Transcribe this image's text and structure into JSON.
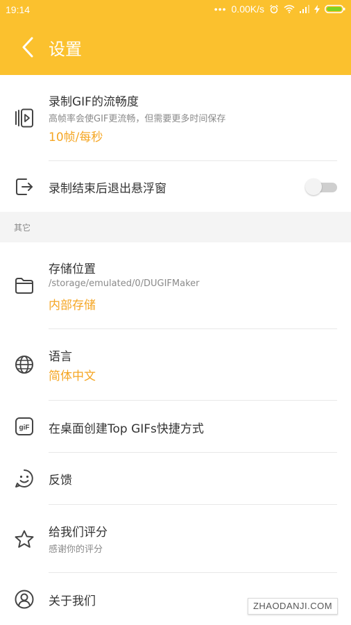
{
  "status_bar": {
    "time": "19:14",
    "network_speed": "0.00K/s"
  },
  "header": {
    "title": "设置",
    "back_icon": "back-arrow-icon",
    "background": "#fbc12e"
  },
  "accent_color": "#f5a623",
  "settings": {
    "gif_fps": {
      "label": "录制GIF的流畅度",
      "subtitle": "高帧率会使GIF更流畅，但需要更多时间保存",
      "value": "10帧/每秒",
      "icon": "video-frames-icon"
    },
    "exit_float": {
      "label": "录制结束后退出悬浮窗",
      "icon": "exit-icon",
      "enabled": false
    }
  },
  "section_other": {
    "title": "其它"
  },
  "other": {
    "storage": {
      "label": "存储位置",
      "path": "/storage/emulated/0/DUGIFMaker",
      "value": "内部存储",
      "icon": "folder-icon"
    },
    "language": {
      "label": "语言",
      "value": "简体中文",
      "icon": "globe-icon"
    },
    "shortcut": {
      "label": "在桌面创建Top GIFs快捷方式",
      "icon": "gif-icon"
    },
    "feedback": {
      "label": "反馈",
      "icon": "smiley-icon"
    },
    "rate": {
      "label": "给我们评分",
      "subtitle": "感谢你的评分",
      "icon": "star-icon"
    },
    "about": {
      "label": "关于我们",
      "icon": "person-icon"
    }
  },
  "watermark": "ZHAODANJI.COM"
}
